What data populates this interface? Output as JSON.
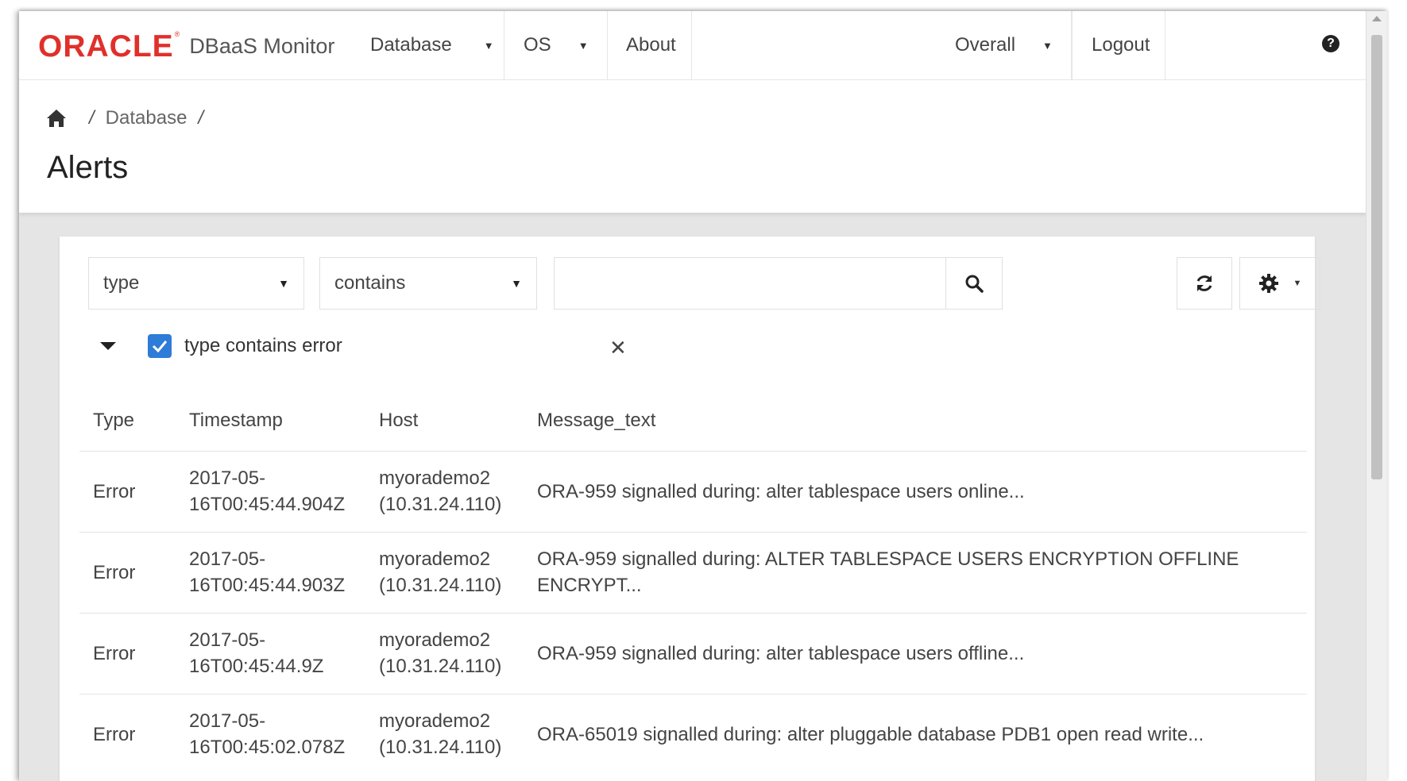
{
  "navbar": {
    "logo": "ORACLE",
    "app_name": "DBaaS Monitor",
    "items": [
      {
        "label": "Database",
        "has_caret": true
      },
      {
        "label": "OS",
        "has_caret": true
      },
      {
        "label": "About",
        "has_caret": false
      }
    ],
    "right_items": [
      {
        "label": "Overall",
        "has_caret": true
      },
      {
        "label": "Logout",
        "has_caret": false
      }
    ],
    "help_icon": "question-circle-icon"
  },
  "breadcrumb": {
    "home_icon": "home-icon",
    "items": [
      "Database"
    ]
  },
  "page": {
    "title": "Alerts"
  },
  "filters": {
    "field_select": "type",
    "operator_select": "contains",
    "search_value": "",
    "active_filter": "type contains error",
    "active_filter_checked": true
  },
  "table": {
    "columns": [
      "Type",
      "Timestamp",
      "Host",
      "Message_text"
    ],
    "rows": [
      {
        "type": "Error",
        "ts1": "2017-05-",
        "ts2": "16T00:45:44.904Z",
        "host1": "myorademo2",
        "host2": "(10.31.24.110)",
        "msg1": "ORA-959 signalled during: alter tablespace users online...",
        "msg2": ""
      },
      {
        "type": "Error",
        "ts1": "2017-05-",
        "ts2": "16T00:45:44.903Z",
        "host1": "myorademo2",
        "host2": "(10.31.24.110)",
        "msg1": "ORA-959 signalled during: ALTER TABLESPACE USERS ENCRYPTION OFFLINE",
        "msg2": "ENCRYPT..."
      },
      {
        "type": "Error",
        "ts1": "2017-05-",
        "ts2": "16T00:45:44.9Z",
        "host1": "myorademo2",
        "host2": "(10.31.24.110)",
        "msg1": "ORA-959 signalled during: alter tablespace users offline...",
        "msg2": ""
      },
      {
        "type": "Error",
        "ts1": "2017-05-",
        "ts2": "16T00:45:02.078Z",
        "host1": "myorademo2",
        "host2": "(10.31.24.110)",
        "msg1": "ORA-65019 signalled during: alter pluggable database PDB1 open read write...",
        "msg2": ""
      }
    ]
  },
  "colors": {
    "brand": "#e0302b",
    "checkbox": "#2f7bd8"
  }
}
